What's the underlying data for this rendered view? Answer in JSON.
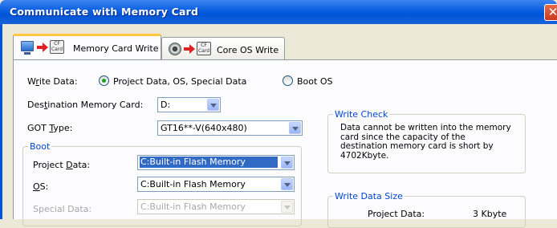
{
  "window": {
    "title": "Communicate with Memory Card",
    "close_symbol": "✕"
  },
  "tabs": [
    {
      "label": "Memory Card Write",
      "active": true,
      "icon_text": "CF Card"
    },
    {
      "label": "Core OS Write",
      "active": false,
      "icon_text": "CF Card"
    }
  ],
  "write_data": {
    "label_pre": "W",
    "label_u": "r",
    "label_post": "ite Data:",
    "options": [
      {
        "label": "Project Data, OS, Special Data",
        "selected": true
      },
      {
        "label": "Boot OS",
        "selected": false
      }
    ]
  },
  "destination": {
    "label_pre": "Des",
    "label_u": "t",
    "label_post": "ination Memory Card:",
    "value": "D:"
  },
  "got_type": {
    "label_pre": "GOT ",
    "label_u": "T",
    "label_post": "ype:",
    "value": "GT16**-V(640x480)"
  },
  "boot": {
    "legend": "Boot",
    "project_data": {
      "label_pre": "Project ",
      "label_u": "D",
      "label_post": "ata:",
      "value": "C:Built-in Flash Memory"
    },
    "os": {
      "label_u": "O",
      "label_post": "S:",
      "value": "C:Built-in Flash Memory"
    },
    "special_data": {
      "label": "Special Data:",
      "value": "C:Built-in Flash Memory"
    }
  },
  "write_check": {
    "legend": "Write Check",
    "lines": [
      "Data cannot be written into the memory",
      "card since the capacity of the",
      "destination memory card is short by",
      "4702Kbyte."
    ]
  },
  "write_data_size": {
    "legend": "Write Data Size",
    "rows": [
      {
        "label": "Project Data:",
        "value": "3 Kbyte"
      }
    ]
  },
  "colors": {
    "titlebar": "#0054e3",
    "accent_tab": "#ffc83c",
    "selection": "#316ac5",
    "group_legend": "#0046d5"
  }
}
